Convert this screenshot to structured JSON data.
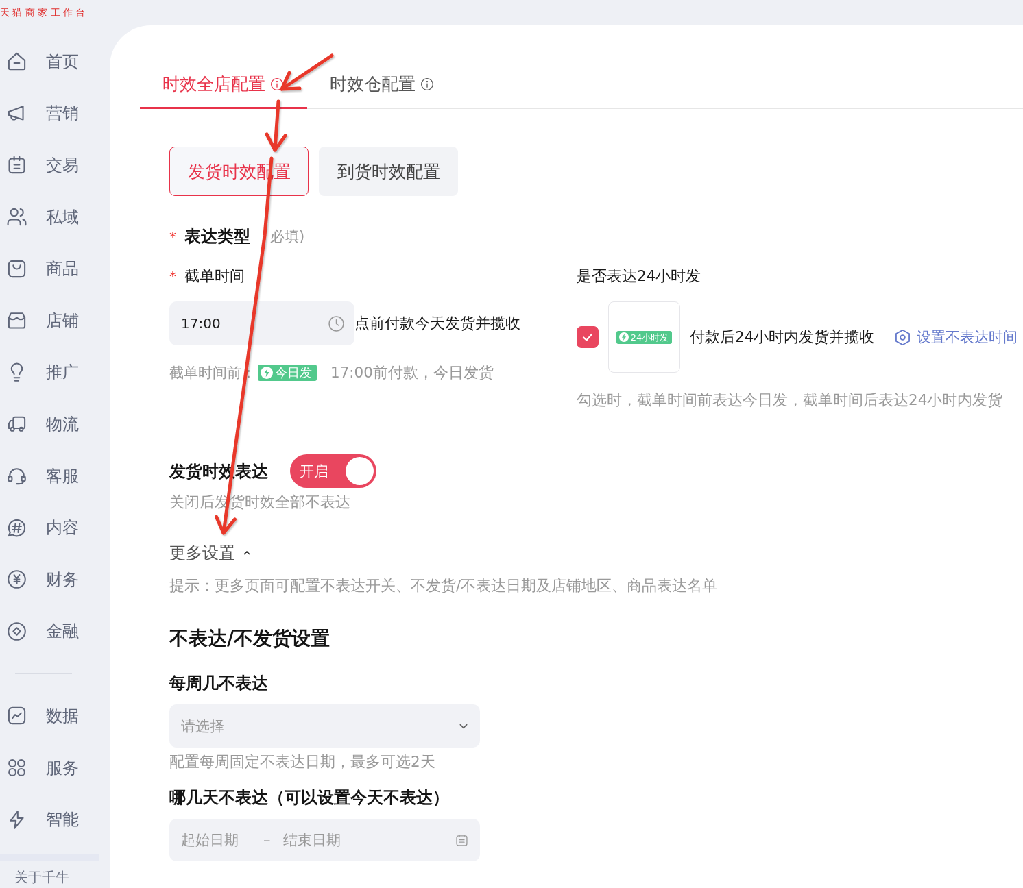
{
  "app_title": "天猫商家工作台",
  "sidebar": {
    "groups": [
      {
        "items": [
          {
            "label": "首页",
            "selected": false
          },
          {
            "label": "营销",
            "selected": false
          },
          {
            "label": "交易",
            "selected": false
          },
          {
            "label": "私域",
            "selected": false
          },
          {
            "label": "商品",
            "selected": false
          },
          {
            "label": "店铺",
            "selected": false
          },
          {
            "label": "推广",
            "selected": false
          },
          {
            "label": "物流",
            "selected": false
          },
          {
            "label": "客服",
            "selected": false
          },
          {
            "label": "内容",
            "selected": false
          },
          {
            "label": "财务",
            "selected": false
          },
          {
            "label": "金融",
            "selected": false
          }
        ]
      },
      {
        "items": [
          {
            "label": "数据",
            "selected": false
          },
          {
            "label": "服务",
            "selected": false
          },
          {
            "label": "智能",
            "selected": false
          }
        ]
      }
    ],
    "footer": "关于千牛"
  },
  "tabs": [
    {
      "label": "时效全店配置",
      "selected": true
    },
    {
      "label": "时效仓配置",
      "selected": false
    }
  ],
  "sub_tabs": [
    {
      "label": "发货时效配置",
      "selected": true
    },
    {
      "label": "到货时效配置",
      "selected": false
    }
  ],
  "expression_type": {
    "required_mark": "*",
    "label": "表达类型",
    "note": "必填)"
  },
  "cutoff": {
    "required_mark": "*",
    "label": "截单时间",
    "value": "17:00",
    "suffix": "点前付款今天发货并揽收",
    "hint_prefix": "截单时间前：",
    "badge": "今日发",
    "hint": "17:00前付款，今日发货"
  },
  "express_24h": {
    "label": "是否表达24小时发",
    "checked": true,
    "badge": "24小时发",
    "text": "付款后24小时内发货并揽收",
    "link": "设置不表达时间",
    "hint": "勾选时，截单时间前表达今日发，截单时间后表达24小时内发货"
  },
  "shipping_display": {
    "label": "发货时效表达",
    "on": true,
    "switch_label": "开启",
    "hint": "关闭后发货时效全部不表达"
  },
  "more_settings": {
    "label": "更多设置",
    "expanded": true,
    "hint": "提示：更多页面可配置不表达开关、不发货/不表达日期及店铺地区、商品表达名单"
  },
  "no_display": {
    "title": "不表达/不发货设置",
    "weekday": {
      "label": "每周几不表达",
      "placeholder": "请选择",
      "hint": "配置每周固定不表达日期，最多可选2天"
    },
    "dates": {
      "label": "哪几天不表达（可以设置今天不表达）",
      "start_placeholder": "起始日期",
      "separator": "–",
      "end_placeholder": "结束日期"
    }
  },
  "annotations": [
    {
      "kind": "arrow"
    },
    {
      "kind": "arrow"
    },
    {
      "kind": "arrow"
    }
  ]
}
